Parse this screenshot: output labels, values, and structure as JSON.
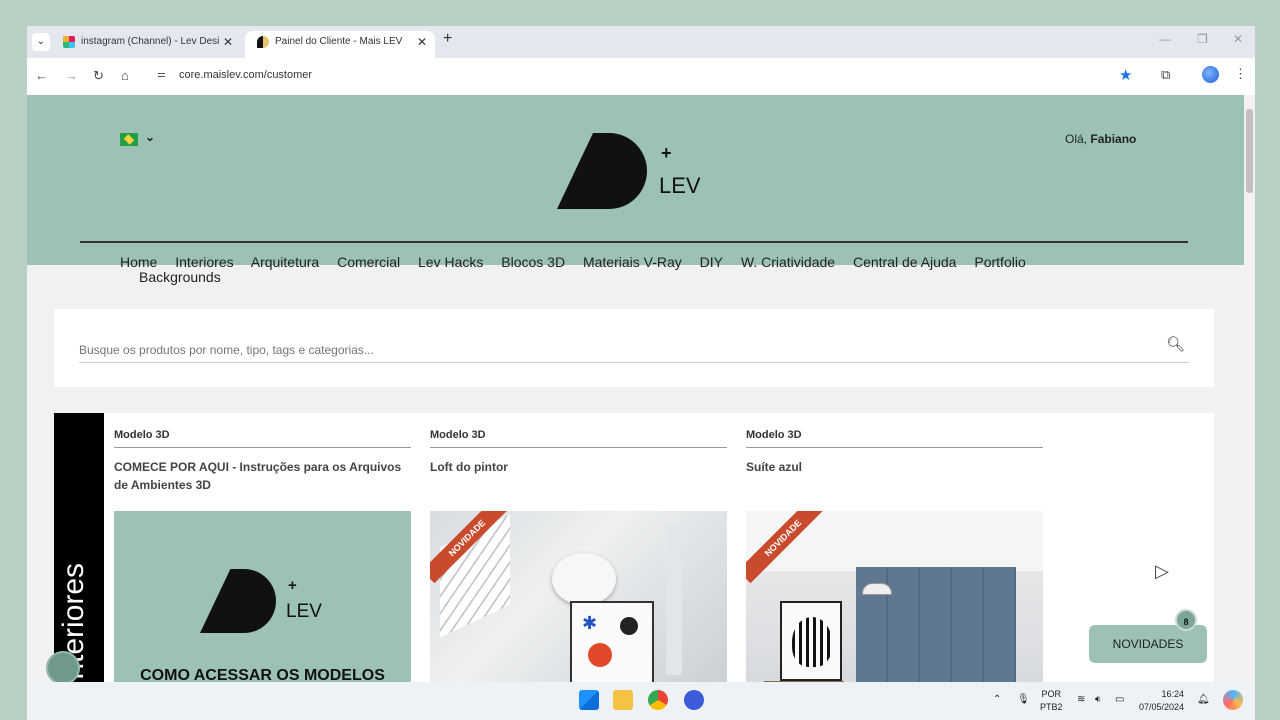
{
  "browser": {
    "tabs": [
      {
        "label": "instagram (Channel) - Lev Desi"
      },
      {
        "label": "Painel do Cliente - Mais LEV"
      }
    ],
    "url": "core.maislev.com/customer"
  },
  "header": {
    "greeting_prefix": "Olá,",
    "greeting_name": "Fabiano",
    "logo_plus": "+",
    "logo_text": "LEV"
  },
  "nav": {
    "items": [
      "Home",
      "Interiores",
      "Arquitetura",
      "Comercial",
      "Lev Hacks",
      "Blocos 3D",
      "Materiais V-Ray",
      "DIY",
      "W. Criatividade",
      "Central de Ajuda",
      "Portfolio"
    ],
    "second_row": "Backgrounds"
  },
  "search": {
    "placeholder": "Busque os produtos por nome, tipo, tags e categorias..."
  },
  "section": {
    "label": "Interiores"
  },
  "products": [
    {
      "category": "Modelo 3D",
      "title": "COMECE POR AQUI - Instruções para os Arquivos de Ambientes 3D",
      "image_text": "COMO ACESSAR OS MODELOS"
    },
    {
      "category": "Modelo 3D",
      "title": "Loft do pintor",
      "badge": "NOVIDADE"
    },
    {
      "category": "Modelo 3D",
      "title": "Suíte azul",
      "badge": "NOVIDADE"
    }
  ],
  "novidades": {
    "label": "NOVIDADES",
    "count": "8"
  },
  "taskbar": {
    "lang_top": "POR",
    "lang_bottom": "PTB2",
    "time": "16:24",
    "date": "07/05/2024"
  },
  "colors": {
    "brand": "#9cc2b5",
    "badge": "#c94a2c"
  }
}
